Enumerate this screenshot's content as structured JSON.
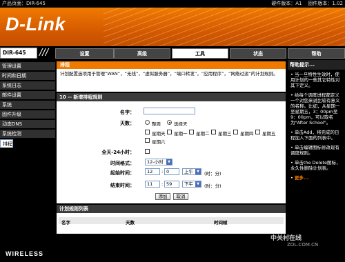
{
  "top": {
    "product_page": "产品页面：DIR-645",
    "hw_version": "硬件版本：A1",
    "fw_version": "固件版本：1.02"
  },
  "brand": {
    "logo": "D-Link",
    "model": "DIR-645",
    "slashes": "///",
    "footer": "WIRELESS"
  },
  "nav": {
    "tabs": [
      "设置",
      "高级",
      "工具",
      "状态",
      "帮助"
    ],
    "active": "工具"
  },
  "sidebar": {
    "items": [
      "管理设置",
      "时间和日期",
      "系统日志",
      "邮件设置",
      "系统",
      "固件升级",
      "动态DNS",
      "系统检测",
      "排程"
    ],
    "selected": "排程"
  },
  "schedule": {
    "title": "排程",
    "description": "计划配置选项用于管理“WAN”，“无线”，“虚拟服务器”，“端口转发”，“应用程序”，“网络过滤”的计划规则。"
  },
  "rule_form": {
    "header": "10 -- 新增排程规则",
    "name_label": "名字：",
    "name_value": "",
    "days_label": "天数：",
    "days_all": "整周",
    "days_select": "选择天",
    "weekdays": [
      "星期天",
      "星期一",
      "星期二",
      "星期三",
      "星期四",
      "星期五",
      "星期六"
    ],
    "allday_label": "全天-24小时：",
    "timefmt_label": "时间格式：",
    "timefmt_value": "12-小时",
    "start_label": "起始时间：",
    "start_hour": "12",
    "start_min": "0",
    "start_ampm": "上午",
    "start_unit": "(时：分)",
    "end_label": "结束时间：",
    "end_hour": "11",
    "end_min": "59",
    "end_ampm": "下午",
    "end_unit": "(时：分)",
    "add_btn": "添加",
    "cancel_btn": "取消"
  },
  "rule_list": {
    "header": "计划规则列表",
    "columns": [
      "名字",
      "天数",
      "时间帧"
    ]
  },
  "help": {
    "title": "帮助提示...",
    "tips": [
      "当一旦特性生效时，使用计划的一些其它特性对其下定义。",
      "给每个调度进程都定义一个对您来说比较有意义的名称。比如，从星期一至星期五，3：00pm至9：00pm，可以取名为\"After School\"。",
      "单击Add，将完成的日程加入下面的列表中。",
      "单击编辑图标修改现有调度规则。",
      "单击the Delete图标，永久性删除计划表。"
    ],
    "more": "更多..."
  },
  "watermark": {
    "line1": "中关村在线",
    "line2": "ZOL.COM.CN"
  }
}
